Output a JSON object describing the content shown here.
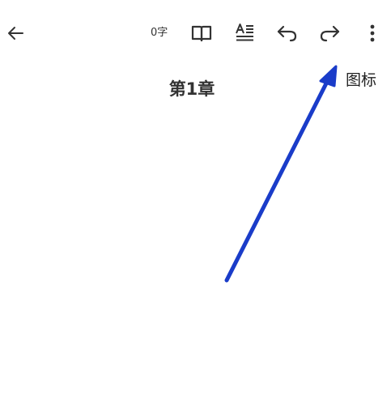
{
  "toolbar": {
    "back_icon": "arrow-left-icon",
    "word_count": "0字",
    "book_icon": "open-book-icon",
    "format_icon": "text-format-icon",
    "undo_icon": "undo-icon",
    "redo_icon": "redo-icon",
    "more_icon": "more-vertical-icon"
  },
  "document": {
    "chapter_title": "第1章"
  },
  "annotation": {
    "label": "图标",
    "arrow_color": "#1a3cc9"
  }
}
